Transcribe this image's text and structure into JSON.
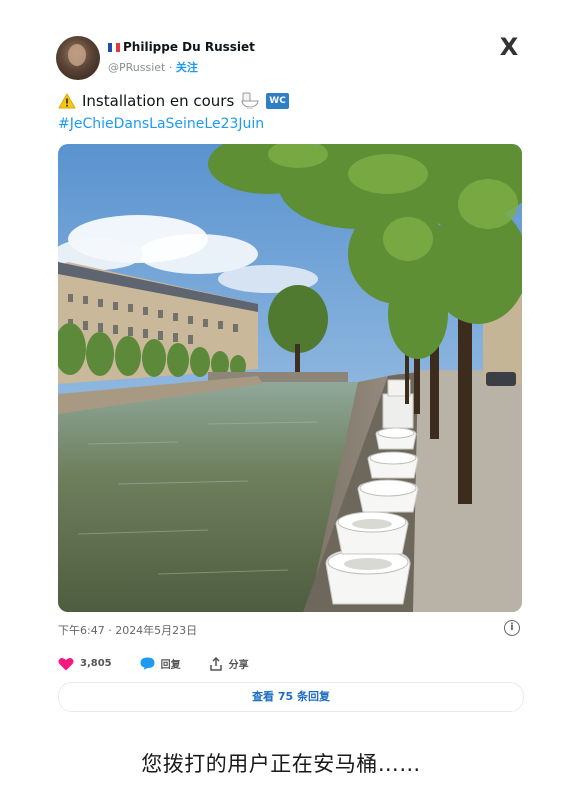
{
  "tweet": {
    "display_name": "Philippe Du Russiet",
    "handle": "@PRussiet",
    "separator": "·",
    "follow_label": "关注",
    "close_label": "X",
    "text": "Installation en cours",
    "wc_label": "WC",
    "hashtag": "#JeChieDansLaSeineLe23Juin",
    "timestamp": "下午6:47 · 2024年5月23日",
    "info_label": "i"
  },
  "actions": {
    "likes_count": "3,805",
    "reply_label": "回复",
    "share_label": "分享",
    "view_replies_label": "查看 75 条回复"
  },
  "caption": "您拨打的用户正在安马桶……",
  "colors": {
    "link": "#1d9bf0",
    "like": "#f91880",
    "reply": "#1d9bf0"
  },
  "icons": [
    "warning-icon",
    "toilet-icon",
    "wc-icon",
    "heart-icon",
    "reply-bubble-icon",
    "share-icon",
    "info-icon",
    "close-icon",
    "flag-icon"
  ]
}
